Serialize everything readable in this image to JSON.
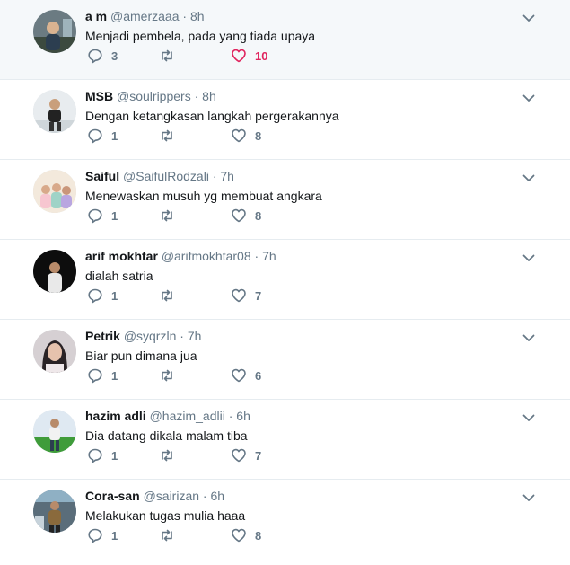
{
  "colors": {
    "like_active": "#e0245e",
    "muted": "#657786",
    "thread_line": "#a6d8f5"
  },
  "icons": {
    "reply": "reply-icon",
    "retweet": "retweet-icon",
    "like": "heart-icon",
    "caret": "chevron-down-icon"
  },
  "tweets": [
    {
      "name": "a m",
      "handle": "@amerzaaa",
      "dot": "·",
      "time": "8h",
      "text": "Menjadi pembela, pada yang tiada upaya",
      "replies": "3",
      "retweets": "",
      "likes": "10",
      "liked": true
    },
    {
      "name": "MSB",
      "handle": "@soulrippers",
      "dot": "·",
      "time": "8h",
      "text": "Dengan ketangkasan langkah pergerakannya",
      "replies": "1",
      "retweets": "",
      "likes": "8",
      "liked": false
    },
    {
      "name": "Saiful",
      "handle": "@SaifulRodzali",
      "dot": "·",
      "time": "7h",
      "text": "Menewaskan musuh yg membuat angkara",
      "replies": "1",
      "retweets": "",
      "likes": "8",
      "liked": false
    },
    {
      "name": "arif mokhtar",
      "handle": "@arifmokhtar08",
      "dot": "·",
      "time": "7h",
      "text": "dialah satria",
      "replies": "1",
      "retweets": "",
      "likes": "7",
      "liked": false
    },
    {
      "name": "Petrik",
      "handle": "@syqrzln",
      "dot": "·",
      "time": "7h",
      "text": "Biar pun dimana jua",
      "replies": "1",
      "retweets": "",
      "likes": "6",
      "liked": false
    },
    {
      "name": "hazim adli",
      "handle": "@hazim_adlii",
      "dot": "·",
      "time": "6h",
      "text": "Dia datang dikala malam tiba",
      "replies": "1",
      "retweets": "",
      "likes": "7",
      "liked": false
    },
    {
      "name": "Cora-san",
      "handle": "@sairizan",
      "dot": "·",
      "time": "6h",
      "text": "Melakukan tugas mulia haaa",
      "replies": "1",
      "retweets": "",
      "likes": "8",
      "liked": false
    }
  ]
}
